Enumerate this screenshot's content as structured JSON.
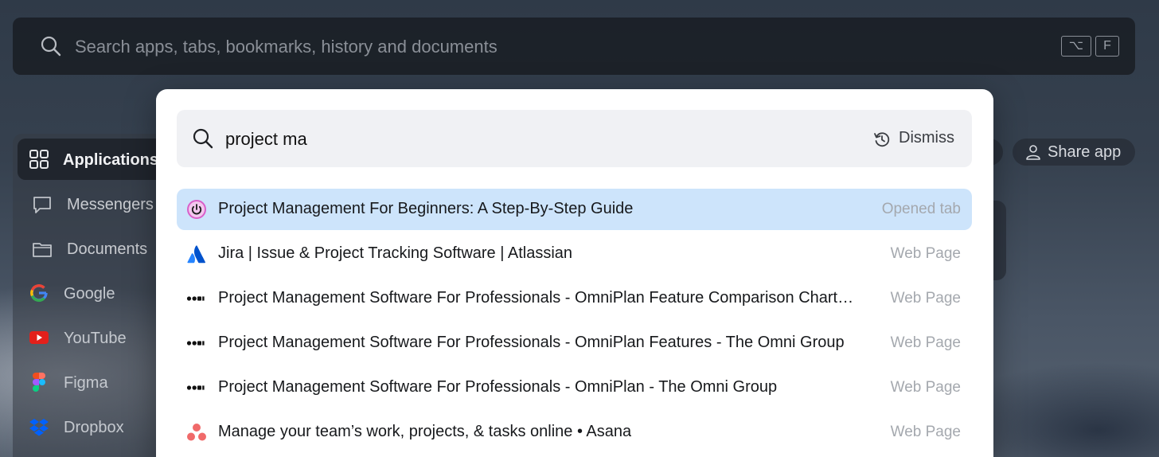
{
  "top_search": {
    "placeholder": "Search apps, tabs, bookmarks, history and documents",
    "shortcut_keys": [
      "⌥",
      "F"
    ]
  },
  "sidebar": {
    "items": [
      {
        "label": "Applications",
        "icon": "grid-icon",
        "active": true
      },
      {
        "label": "Messengers",
        "icon": "chat-bubble-icon"
      },
      {
        "label": "Documents",
        "icon": "folder-icon"
      },
      {
        "label": "Google",
        "icon": "google-icon"
      },
      {
        "label": "YouTube",
        "icon": "youtube-icon"
      },
      {
        "label": "Figma",
        "icon": "figma-icon"
      },
      {
        "label": "Dropbox",
        "icon": "dropbox-icon"
      }
    ]
  },
  "share_app": {
    "label": "Share app",
    "icon": "person-icon"
  },
  "modal": {
    "query": "project ma",
    "dismiss_label": "Dismiss",
    "results": [
      {
        "title": "Project Management For Beginners: A Step-By-Step Guide",
        "type": "Opened tab",
        "icon": "power-icon",
        "selected": true
      },
      {
        "title": "Jira | Issue & Project Tracking Software | Atlassian",
        "type": "Web Page",
        "icon": "atlassian-icon"
      },
      {
        "title": "Project Management Software For Professionals - OmniPlan Feature Comparison Chart…",
        "type": "Web Page",
        "icon": "omni-group-icon"
      },
      {
        "title": "Project Management Software For Professionals - OmniPlan Features - The Omni Group",
        "type": "Web Page",
        "icon": "omni-group-icon"
      },
      {
        "title": "Project Management Software For Professionals - OmniPlan - The Omni Group",
        "type": "Web Page",
        "icon": "omni-group-icon"
      },
      {
        "title": "Manage your team’s work, projects, & tasks online • Asana",
        "type": "Web Page",
        "icon": "asana-icon"
      }
    ]
  },
  "colors": {
    "selected_row": "#cde4fb",
    "modal_search_bg": "#f0f1f4"
  }
}
